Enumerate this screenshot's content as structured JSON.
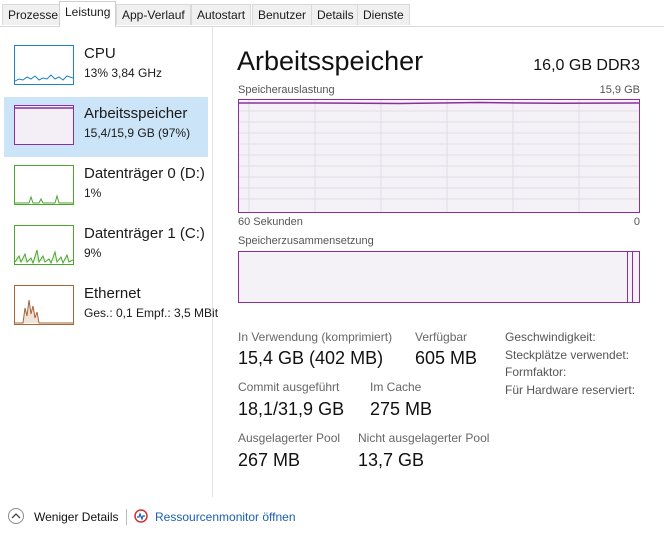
{
  "tabs": [
    "Prozesse",
    "Leistung",
    "App-Verlauf",
    "Autostart",
    "Benutzer",
    "Details",
    "Dienste"
  ],
  "active_tab": "Leistung",
  "sidebar": {
    "items": [
      {
        "title": "CPU",
        "subtitle": "13% 3,84 GHz",
        "color": "#1c83c8",
        "icon": "cpu-graph"
      },
      {
        "title": "Arbeitsspeicher",
        "subtitle": "15,4/15,9 GB (97%)",
        "color": "#8b2f9e",
        "icon": "memory-graph"
      },
      {
        "title": "Datenträger 0 (D:)",
        "subtitle": "1%",
        "color": "#4da630",
        "icon": "disk-graph"
      },
      {
        "title": "Datenträger 1 (C:)",
        "subtitle": "9%",
        "color": "#4da630",
        "icon": "disk-graph"
      },
      {
        "title": "Ethernet",
        "subtitle": "Ges.: 0,1  Empf.: 3,5 MBit",
        "color": "#a7643a",
        "icon": "network-graph"
      }
    ]
  },
  "main": {
    "title": "Arbeitsspeicher",
    "spec": "16,0 GB DDR3",
    "usage_label": "Speicherauslastung",
    "usage_max": "15,9 GB",
    "time_left": "60 Sekunden",
    "time_right": "0",
    "composition_label": "Speicherzusammensetzung",
    "usage_fraction": 0.97,
    "stats": {
      "in_use_label": "In Verwendung (komprimiert)",
      "in_use_value": "15,4 GB (402 MB)",
      "available_label": "Verfügbar",
      "available_value": "605 MB",
      "commit_label": "Commit ausgeführt",
      "commit_value": "18,1/31,9 GB",
      "cache_label": "Im Cache",
      "cache_value": "275 MB",
      "paged_label": "Ausgelagerter Pool",
      "paged_value": "267 MB",
      "nonpaged_label": "Nicht ausgelagerter Pool",
      "nonpaged_value": "13,7 GB"
    },
    "properties": [
      "Geschwindigkeit:",
      "Steckplätze verwendet:",
      "Formfaktor:",
      "Für Hardware reserviert:"
    ]
  },
  "footer": {
    "fewer_details": "Weniger Details",
    "resource_monitor": "Ressourcenmonitor öffnen"
  },
  "colors": {
    "memory": "#8b2f9e",
    "selection": "#cce4f7",
    "link": "#1a5fb4"
  }
}
